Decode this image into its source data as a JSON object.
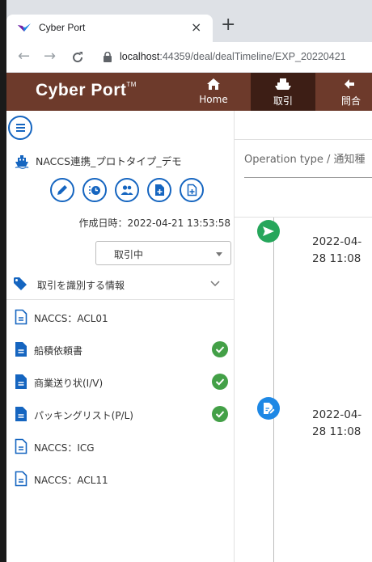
{
  "browser": {
    "tab_title": "Cyber Port",
    "tab_close": "×",
    "new_tab": "+",
    "url_host": "localhost",
    "url_rest": ":44359/deal/dealTimeline/EXP_20220421"
  },
  "app": {
    "logo": "Cyber Port",
    "logo_tm": "TM",
    "nav": {
      "home": "Home",
      "deal": "取引",
      "inquiry": "問合"
    },
    "accent_color": "#6d3a2b",
    "primary_color": "#1565c0"
  },
  "sidebar": {
    "deal_name": "NACCS連携_プロトタイプ_デモ",
    "created_at": "作成日時：2022-04-21 13:53:58",
    "status": "取引中",
    "id_section": "取引を識別する情報",
    "documents": [
      {
        "label": "NACCS：ACL01",
        "icon": "file-outline-icon",
        "checked": false
      },
      {
        "label": "船積依頼書",
        "icon": "file-icon",
        "checked": true
      },
      {
        "label": "商業送り状(I/V)",
        "icon": "file-icon",
        "checked": true
      },
      {
        "label": "パッキングリスト(P/L)",
        "icon": "file-icon",
        "checked": true
      },
      {
        "label": "NACCS：ICG",
        "icon": "file-outline-icon",
        "checked": false
      },
      {
        "label": "NACCS：ACL11",
        "icon": "file-outline-icon",
        "checked": false
      }
    ]
  },
  "main": {
    "operation_label": "Operation type / 通知種",
    "timeline": [
      {
        "date_line1": "2022-04-",
        "date_line2": "28 11:08",
        "icon": "send-icon"
      },
      {
        "date_line1": "2022-04-",
        "date_line2": "28 11:08",
        "icon": "document-edit-icon"
      }
    ]
  }
}
